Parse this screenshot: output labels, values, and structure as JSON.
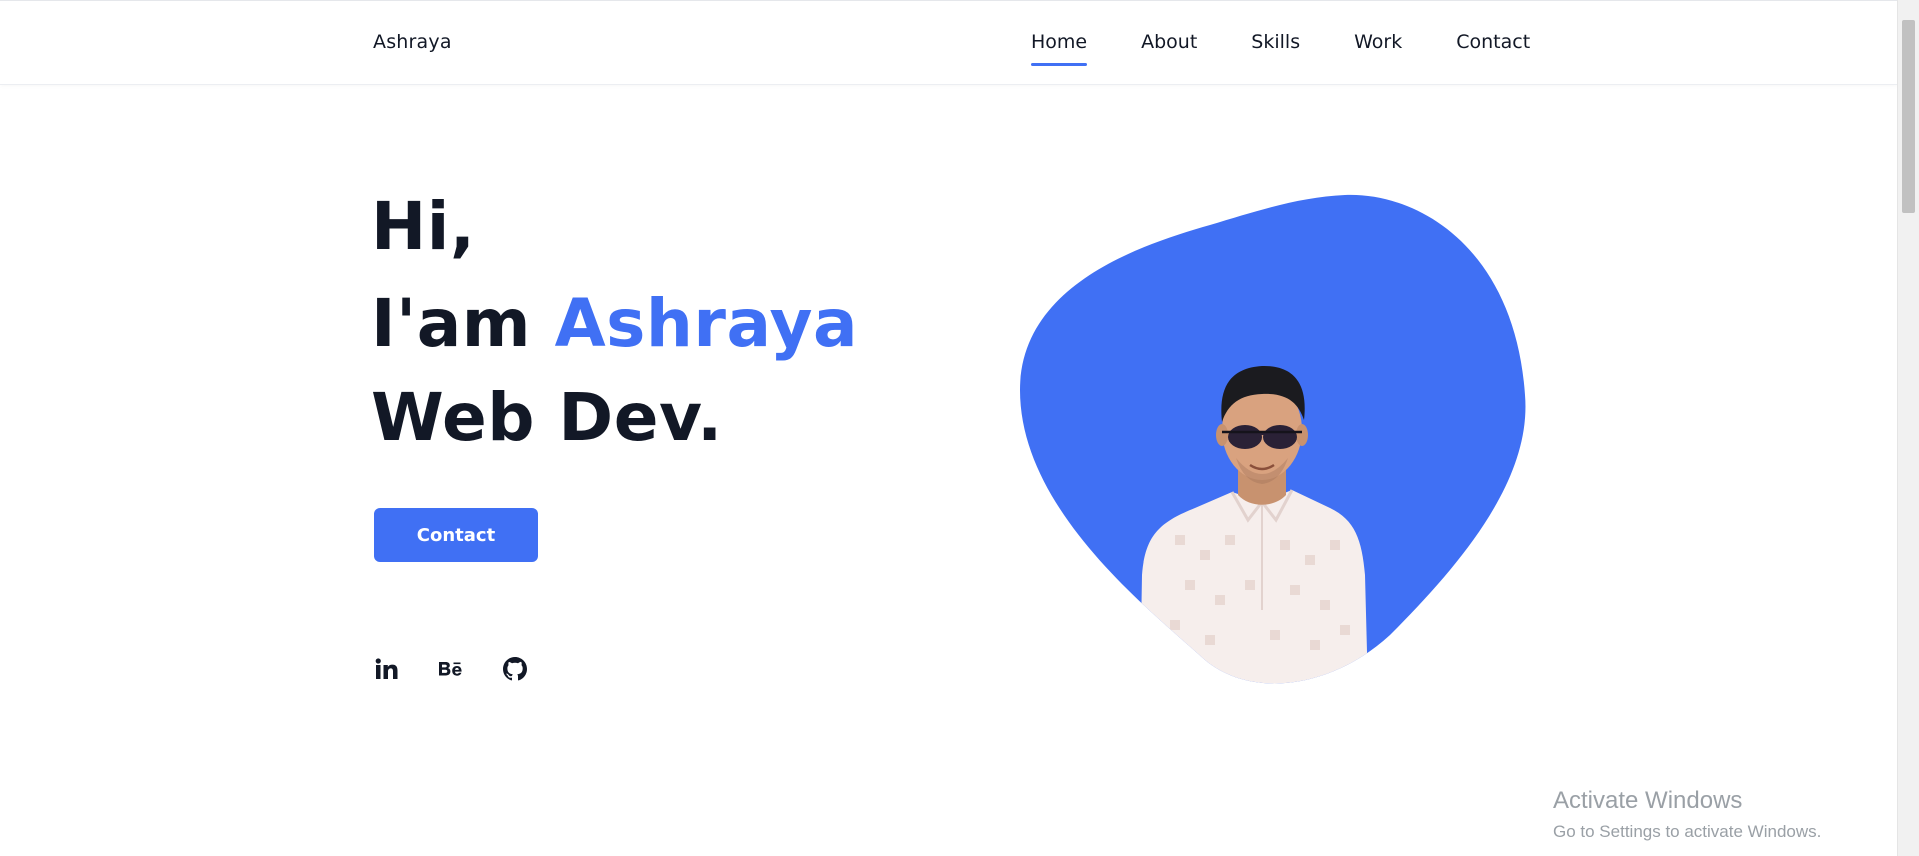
{
  "header": {
    "logo": "Ashraya",
    "nav": [
      {
        "label": "Home",
        "active": true
      },
      {
        "label": "About",
        "active": false
      },
      {
        "label": "Skills",
        "active": false
      },
      {
        "label": "Work",
        "active": false
      },
      {
        "label": "Contact",
        "active": false
      }
    ]
  },
  "hero": {
    "line1": "Hi,",
    "line2_prefix": "I'am ",
    "line2_name": "Ashraya",
    "line3": "Web Dev.",
    "button_label": "Contact"
  },
  "socials": [
    {
      "name": "linkedin-icon",
      "glyph": "in"
    },
    {
      "name": "behance-icon",
      "glyph": "Bē"
    },
    {
      "name": "github-icon",
      "glyph": ""
    }
  ],
  "colors": {
    "accent": "#4070f4",
    "text": "#121826"
  },
  "watermark": {
    "title": "Activate Windows",
    "subtitle": "Go to Settings to activate Windows."
  }
}
